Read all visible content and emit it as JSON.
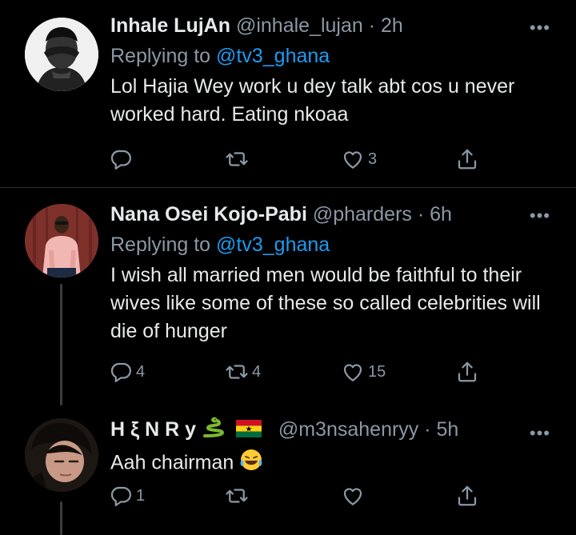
{
  "tweets": [
    {
      "name": "Inhale LujAn",
      "handle_time": "@inhale_lujan · 2h",
      "replying_prefix": "Replying to ",
      "replying_to": "@tv3_ghana",
      "text": "Lol Hajia Wey work u dey talk abt cos u never worked hard. Eating nkoaa",
      "reply_count": "",
      "retweet_count": "",
      "like_count": "3"
    },
    {
      "name": "Nana Osei Kojo-Pabi",
      "handle_time": "@pharders · 6h",
      "replying_prefix": "Replying to ",
      "replying_to": "@tv3_ghana",
      "text": "I wish all married men would be faithful to their wives like some of these so called celebrities will die of hunger",
      "reply_count": "4",
      "retweet_count": "4",
      "like_count": "15"
    },
    {
      "name": "H ξ N R y",
      "handle_time": "@m3nsahenryy · 5h",
      "text": "Aah chairman",
      "reply_count": "1",
      "retweet_count": "",
      "like_count": ""
    }
  ],
  "icons": {
    "reply": "reply-icon",
    "retweet": "retweet-icon",
    "like": "heart-icon",
    "share": "share-icon",
    "more": "more-icon",
    "snake": "snake-emoji",
    "flag": "ghana-flag-emoji",
    "laugh": "face-with-tears-of-joy-emoji"
  },
  "colors": {
    "background": "#000000",
    "text": "#e7e9ea",
    "muted": "#8b98a5",
    "link": "#1d9bf0",
    "divider": "#2f3336"
  }
}
